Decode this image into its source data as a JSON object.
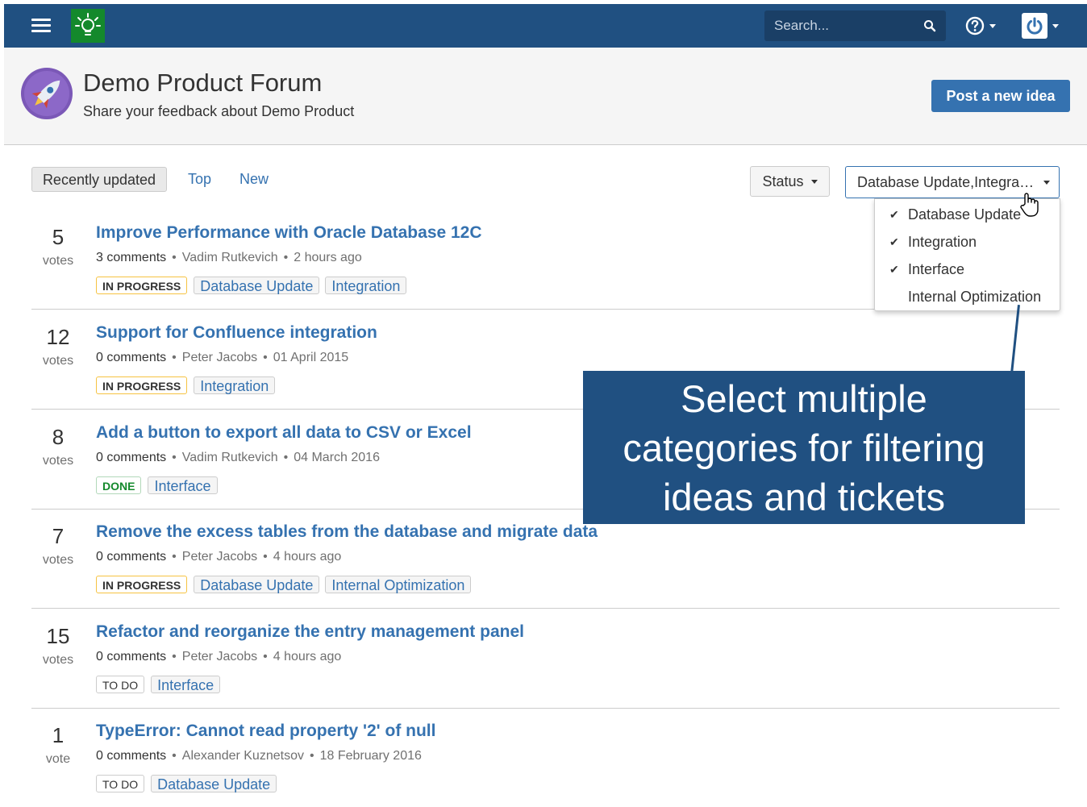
{
  "nav": {
    "search": {
      "placeholder": "Search..."
    }
  },
  "header": {
    "title": "Demo Product Forum",
    "subtitle": "Share your feedback about Demo Product",
    "post_button": "Post a new idea"
  },
  "tabs": [
    {
      "label": "Recently updated",
      "active": true
    },
    {
      "label": "Top"
    },
    {
      "label": "New"
    }
  ],
  "filters": {
    "status_label": "Status",
    "category_label": "Database Update,Integration,Interface",
    "category_options": [
      {
        "label": "Database Update",
        "checked": true
      },
      {
        "label": "Integration",
        "checked": true
      },
      {
        "label": "Interface",
        "checked": true
      },
      {
        "label": "Internal Optimization",
        "checked": false
      }
    ]
  },
  "ideas": [
    {
      "votes": "5",
      "vote_label": "votes",
      "title": "Improve Performance with Oracle Database 12C",
      "comments": "3",
      "comments_label": "comments",
      "author": "Vadim Rutkevich",
      "time": "2 hours ago",
      "status": "IN PROGRESS",
      "tags": [
        "Database Update",
        "Integration"
      ]
    },
    {
      "votes": "12",
      "vote_label": "votes",
      "title": "Support for Confluence integration",
      "comments": "0",
      "comments_label": "comments",
      "author": "Peter Jacobs",
      "time": "01 April 2015",
      "status": "IN PROGRESS",
      "tags": [
        "Integration"
      ]
    },
    {
      "votes": "8",
      "vote_label": "votes",
      "title": "Add a button to export all data to CSV or Excel",
      "comments": "0",
      "comments_label": "comments",
      "author": "Vadim Rutkevich",
      "time": "04 March 2016",
      "status": "DONE",
      "tags": [
        "Interface"
      ]
    },
    {
      "votes": "7",
      "vote_label": "votes",
      "title": "Remove the excess tables from the database and migrate data",
      "comments": "0",
      "comments_label": "comments",
      "author": "Peter Jacobs",
      "time": "4 hours ago",
      "status": "IN PROGRESS",
      "tags": [
        "Database Update",
        "Internal Optimization"
      ]
    },
    {
      "votes": "15",
      "vote_label": "votes",
      "title": "Refactor and reorganize the entry management panel",
      "comments": "0",
      "comments_label": "comments",
      "author": "Peter Jacobs",
      "time": "4 hours ago",
      "status": "TO DO",
      "tags": [
        "Interface"
      ]
    },
    {
      "votes": "1",
      "vote_label": "vote",
      "title": "TypeError: Cannot read property '2' of null",
      "comments": "0",
      "comments_label": "comments",
      "author": "Alexander Kuznetsov",
      "time": "18 February 2016",
      "status": "TO DO",
      "tags": [
        "Database Update"
      ]
    }
  ],
  "callout": {
    "line1": "Select multiple",
    "line2": "categories for filtering",
    "line3": "ideas and tickets"
  },
  "colors": {
    "nav_bg": "#205081",
    "link": "#3572b0",
    "logo_bg": "#14892c",
    "in_progress_border": "#f6c342",
    "done_text": "#14892c"
  }
}
